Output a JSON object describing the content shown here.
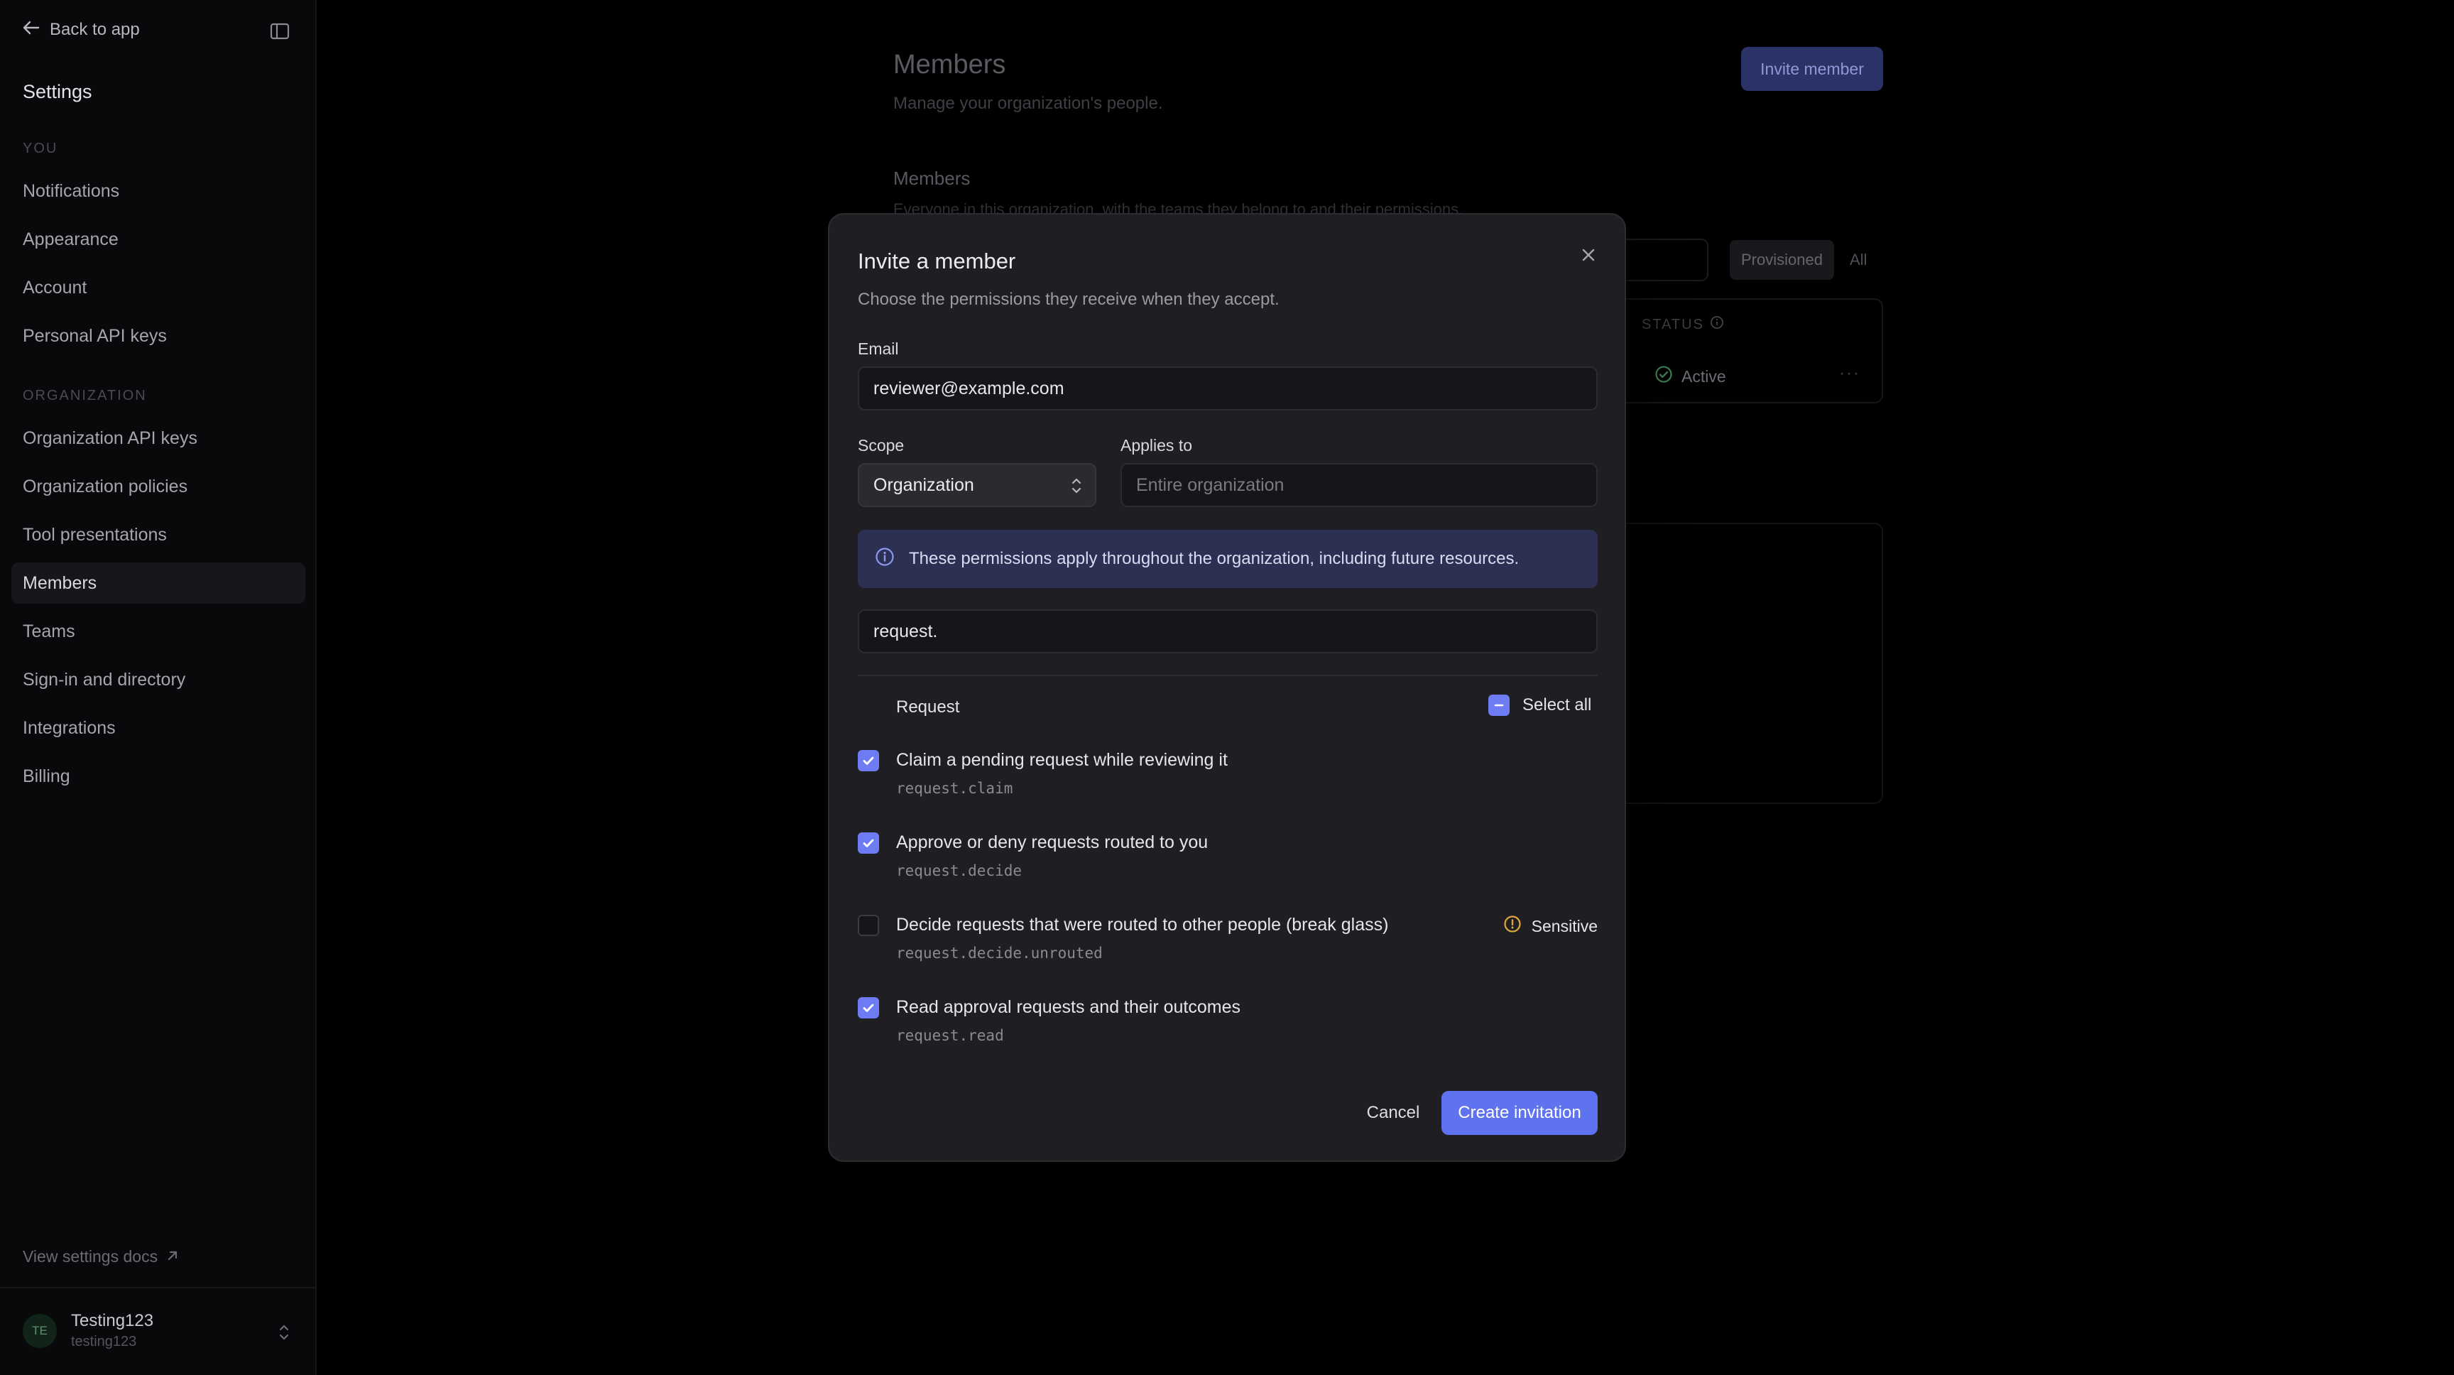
{
  "sidebar": {
    "back_label": "Back to app",
    "title": "Settings",
    "section_you": "YOU",
    "items_you": [
      {
        "label": "Notifications"
      },
      {
        "label": "Appearance"
      },
      {
        "label": "Account"
      },
      {
        "label": "Personal API keys"
      }
    ],
    "section_org": "ORGANIZATION",
    "items_org": [
      {
        "label": "Organization API keys"
      },
      {
        "label": "Organization policies"
      },
      {
        "label": "Tool presentations"
      },
      {
        "label": "Members",
        "active": true
      },
      {
        "label": "Teams"
      },
      {
        "label": "Sign-in and directory"
      },
      {
        "label": "Integrations"
      },
      {
        "label": "Billing"
      }
    ],
    "docs_link": "View settings docs",
    "user": {
      "initials": "TE",
      "name": "Testing123",
      "handle": "testing123"
    }
  },
  "page": {
    "title": "Members",
    "subtitle": "Manage your organization's people.",
    "invite_button": "Invite member",
    "section_title": "Members",
    "section_desc": "Everyone in this organization, with the teams they belong to and their permissions.",
    "filters": [
      "Provisioned",
      "All"
    ],
    "status_header": "STATUS",
    "status_value": "Active",
    "row_menu": "···"
  },
  "dialog": {
    "title": "Invite a member",
    "subtitle": "Choose the permissions they receive when they accept.",
    "email_label": "Email",
    "email_value": "reviewer@example.com",
    "scope_label": "Scope",
    "scope_value": "Organization",
    "applies_label": "Applies to",
    "applies_placeholder": "Entire organization",
    "info_text": "These permissions apply throughout the organization, including future resources.",
    "filter_value": "request.",
    "group_label": "Request",
    "select_all": "Select all",
    "permissions": [
      {
        "title": "Claim a pending request while reviewing it",
        "code": "request.claim",
        "checked": true
      },
      {
        "title": "Approve or deny requests routed to you",
        "code": "request.decide",
        "checked": true
      },
      {
        "title": "Decide requests that were routed to other people (break glass)",
        "code": "request.decide.unrouted",
        "checked": false,
        "badge": "Sensitive"
      },
      {
        "title": "Read approval requests and their outcomes",
        "code": "request.read",
        "checked": true
      }
    ],
    "cancel": "Cancel",
    "create": "Create invitation"
  },
  "colors": {
    "accent": "#5f73f0",
    "info_bg": "#2c3154",
    "warning": "#e0a83a",
    "success": "#4caf6a"
  }
}
